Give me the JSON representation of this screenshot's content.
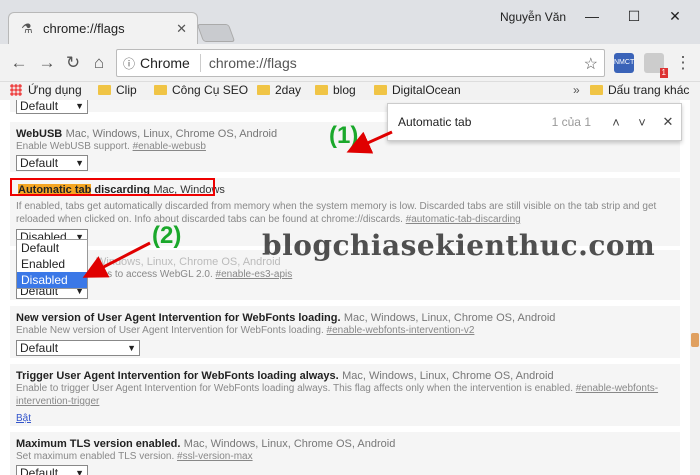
{
  "window": {
    "tab_title": "chrome://flags",
    "user_name": "Nguyễn Văn",
    "minimize": "—",
    "maximize": "☐",
    "close": "✕"
  },
  "toolbar": {
    "site_label": "Chrome",
    "url": "chrome://flags",
    "ext1_label": "NMCT",
    "ext2_badge": "1"
  },
  "bookmarks": {
    "apps": "Ứng dụng",
    "items": [
      "Clip",
      "Công Cụ SEO",
      "2day",
      "blog",
      "DigitalOcean"
    ],
    "other": "Dấu trang khác",
    "more": "»"
  },
  "findbar": {
    "query": "Automatic tab",
    "count": "1 của 1"
  },
  "flags": {
    "top_select": "Default",
    "webusb": {
      "name": "WebUSB",
      "platforms": "Mac, Windows, Linux, Chrome OS, Android",
      "desc": "Enable WebUSB support.",
      "link": "#enable-webusb",
      "select": "Default"
    },
    "discard": {
      "name_hl": "Automatic tab",
      "name_rest": " discarding",
      "platforms": "Mac, Windows",
      "desc": "If enabled, tabs get automatically discarded from memory when the system memory is low. Discarded tabs are still visible on the tab strip and get reloaded when clicked on. Info about discarded tabs can be found at chrome://discards.",
      "link": "#automatic-tab-discarding",
      "select": "Disabled",
      "options": [
        "Default",
        "Enabled",
        "Disabled"
      ]
    },
    "es3": {
      "platforms_partial": "Windows, Linux, Chrome OS, Android",
      "desc_partial": "ons to access WebGL 2.0.",
      "link": "#enable-es3-apis",
      "select": "Default"
    },
    "webfonts": {
      "name": "New version of User Agent Intervention for WebFonts loading.",
      "platforms": "Mac, Windows, Linux, Chrome OS, Android",
      "desc": "Enable New version of User Agent Intervention for WebFonts loading.",
      "link": "#enable-webfonts-intervention-v2",
      "select": "Default"
    },
    "trigger": {
      "name": "Trigger User Agent Intervention for WebFonts loading always.",
      "platforms": "Mac, Windows, Linux, Chrome OS, Android",
      "desc": "Enable to trigger User Agent Intervention for WebFonts loading always. This flag affects only when the intervention is enabled.",
      "link": "#enable-webfonts-intervention-trigger",
      "action": "Bật"
    },
    "tls": {
      "name": "Maximum TLS version enabled.",
      "platforms": "Mac, Windows, Linux, Chrome OS, Android",
      "desc": "Set maximum enabled TLS version.",
      "link": "#ssl-version-max",
      "select": "Default"
    }
  },
  "annotations": {
    "one": "(1)",
    "two": "(2)",
    "watermark": "blogchiasekienthuc.com",
    "accent_color": "#1aa82b",
    "arrow_color": "#e00000"
  }
}
